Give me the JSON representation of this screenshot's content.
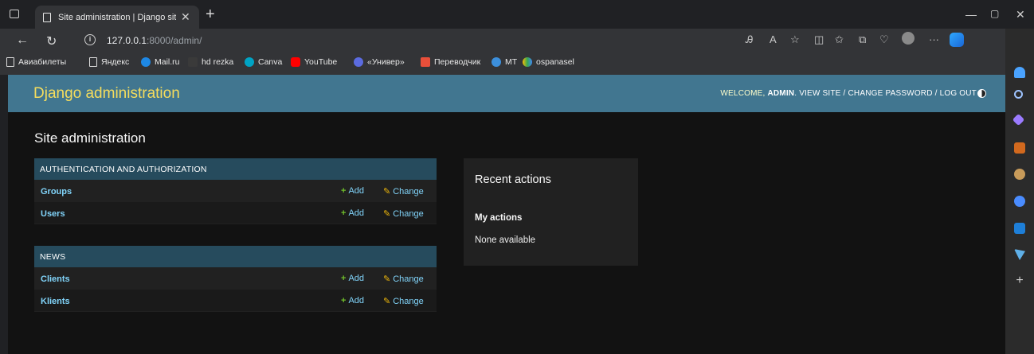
{
  "browser": {
    "tab_title": "Site administration | Django site admin",
    "url_host": "127.0.0.1",
    "url_rest": ":8000/admin/",
    "bookmarks": [
      "Авиабилеты",
      "Яндекс",
      "Mail.ru",
      "hd rezka",
      "Canva",
      "YouTube",
      "«Универ»",
      "Переводчик",
      "MT",
      "ospanasel"
    ]
  },
  "header": {
    "branding": "Django administration",
    "welcome": "WELCOME, ",
    "username": "ADMIN",
    "links": ". VIEW SITE / CHANGE PASSWORD / LOG OUT"
  },
  "content": {
    "title": "Site administration"
  },
  "modules": [
    {
      "caption": "AUTHENTICATION AND AUTHORIZATION",
      "rows": [
        {
          "name": "Groups",
          "add": "Add",
          "change": "Change"
        },
        {
          "name": "Users",
          "add": "Add",
          "change": "Change"
        }
      ]
    },
    {
      "caption": "NEWS",
      "rows": [
        {
          "name": "Clients",
          "add": "Add",
          "change": "Change"
        },
        {
          "name": "Klients",
          "add": "Add",
          "change": "Change"
        }
      ]
    }
  ],
  "recent": {
    "title": "Recent actions",
    "subtitle": "My actions",
    "empty": "None available"
  },
  "colors": {
    "header_bg": "#417690",
    "branding": "#f5dd5d",
    "module_caption": "#264b5d",
    "link": "#81d4fa",
    "add_plus": "#70bf2b",
    "change_pencil": "#efb80b"
  }
}
